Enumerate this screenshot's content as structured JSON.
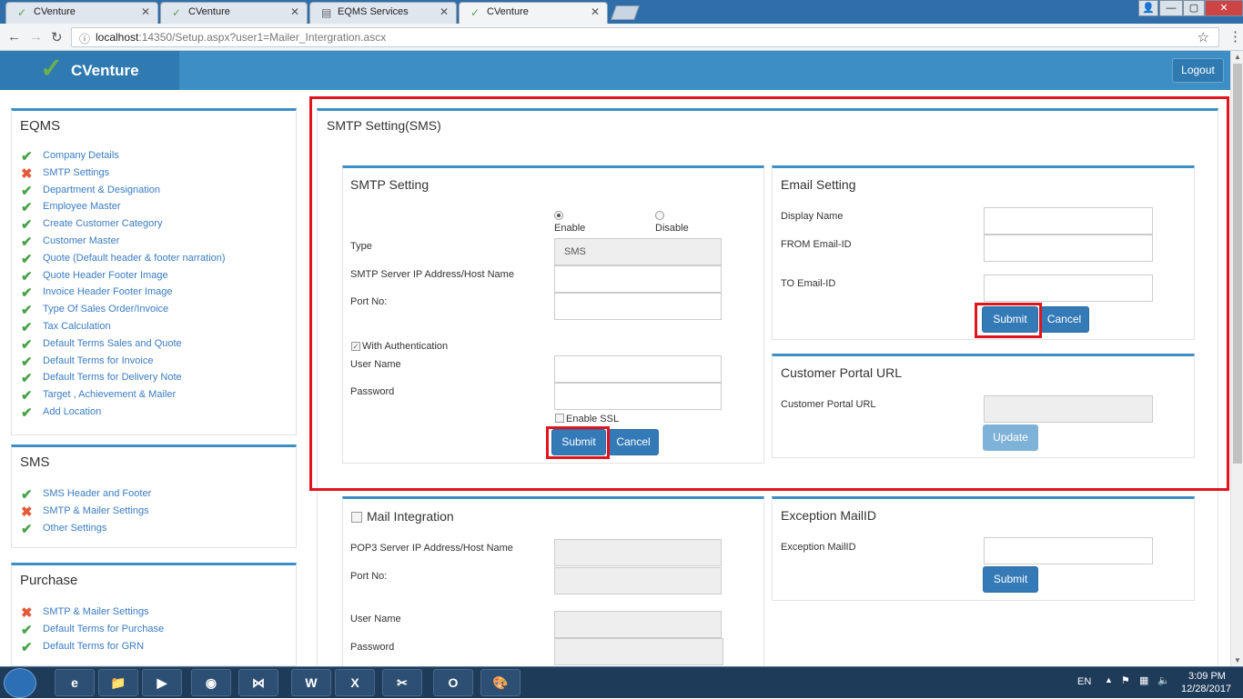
{
  "browser": {
    "tabs": [
      {
        "title": "CVenture"
      },
      {
        "title": "CVenture"
      },
      {
        "title": "EQMS Services"
      },
      {
        "title": "CVenture"
      }
    ],
    "window_controls": {
      "user": "👤",
      "minimize": "—",
      "maximize": "▢",
      "close": "✕"
    },
    "url_host": "localhost",
    "url_rest": ":14350/Setup.aspx?user1=Mailer_Intergration.ascx"
  },
  "app": {
    "brand": "CVenture",
    "logout_label": "Logout"
  },
  "sidebar": {
    "eqms": {
      "title": "EQMS",
      "items": [
        {
          "label": "Company Details",
          "status": "ok"
        },
        {
          "label": "SMTP Settings",
          "status": "bad"
        },
        {
          "label": "Department & Designation",
          "status": "ok"
        },
        {
          "label": "Employee Master",
          "status": "ok"
        },
        {
          "label": "Create Customer Category",
          "status": "ok"
        },
        {
          "label": "Customer Master",
          "status": "ok"
        },
        {
          "label": "Quote (Default header & footer narration)",
          "status": "ok"
        },
        {
          "label": "Quote Header Footer Image",
          "status": "ok"
        },
        {
          "label": "Invoice Header Footer Image",
          "status": "ok"
        },
        {
          "label": "Type Of Sales Order/Invoice",
          "status": "ok"
        },
        {
          "label": "Tax Calculation",
          "status": "ok"
        },
        {
          "label": "Default Terms Sales and Quote",
          "status": "ok"
        },
        {
          "label": "Default Terms for Invoice",
          "status": "ok"
        },
        {
          "label": "Default Terms for Delivery Note",
          "status": "ok"
        },
        {
          "label": "Target , Achievement & Mailer",
          "status": "ok"
        },
        {
          "label": "Add Location",
          "status": "ok"
        }
      ]
    },
    "sms": {
      "title": "SMS",
      "items": [
        {
          "label": "SMS Header and Footer",
          "status": "ok"
        },
        {
          "label": "SMTP & Mailer Settings",
          "status": "bad"
        },
        {
          "label": "Other Settings",
          "status": "ok"
        }
      ]
    },
    "purchase": {
      "title": "Purchase",
      "items": [
        {
          "label": "SMTP & Mailer Settings",
          "status": "bad"
        },
        {
          "label": "Default Terms for Purchase",
          "status": "ok"
        },
        {
          "label": "Default Terms for GRN",
          "status": "ok"
        }
      ]
    }
  },
  "main": {
    "title": "SMTP Setting(SMS)",
    "smtp": {
      "title": "SMTP Setting",
      "enable_label": "Enable",
      "disable_label": "Disable",
      "type_label": "Type",
      "type_value": "SMS",
      "server_label": "SMTP Server IP Address/Host Name",
      "port_label": "Port No:",
      "auth_label": "With Authentication",
      "username_label": "User Name",
      "password_label": "Password",
      "ssl_label": "Enable SSL",
      "submit_label": "Submit",
      "cancel_label": "Cancel"
    },
    "email": {
      "title": "Email Setting",
      "display_name_label": "Display Name",
      "from_label": "FROM Email-ID",
      "to_label": "TO Email-ID",
      "submit_label": "Submit",
      "cancel_label": "Cancel"
    },
    "portal": {
      "title": "Customer Portal URL",
      "url_label": "Customer Portal URL",
      "update_label": "Update"
    },
    "mail_integration": {
      "title": "Mail Integration",
      "pop3_label": "POP3 Server IP Address/Host Name",
      "port_label": "Port No:",
      "username_label": "User Name",
      "password_label": "Password"
    },
    "exception": {
      "title": "Exception MailID",
      "label": "Exception MailID",
      "submit_label": "Submit"
    }
  },
  "taskbar": {
    "apps": [
      "e",
      "📁",
      "▶",
      "◉",
      "⋈",
      "W",
      "X",
      "✂",
      "O",
      "🎨"
    ],
    "lang": "EN",
    "time": "3:09 PM",
    "date": "12/28/2017"
  },
  "colors": {
    "header": "#3d8ec4",
    "button": "#337ab7",
    "highlight": "#e1141e",
    "ok": "#4aa34a",
    "bad": "#e35a3a"
  }
}
